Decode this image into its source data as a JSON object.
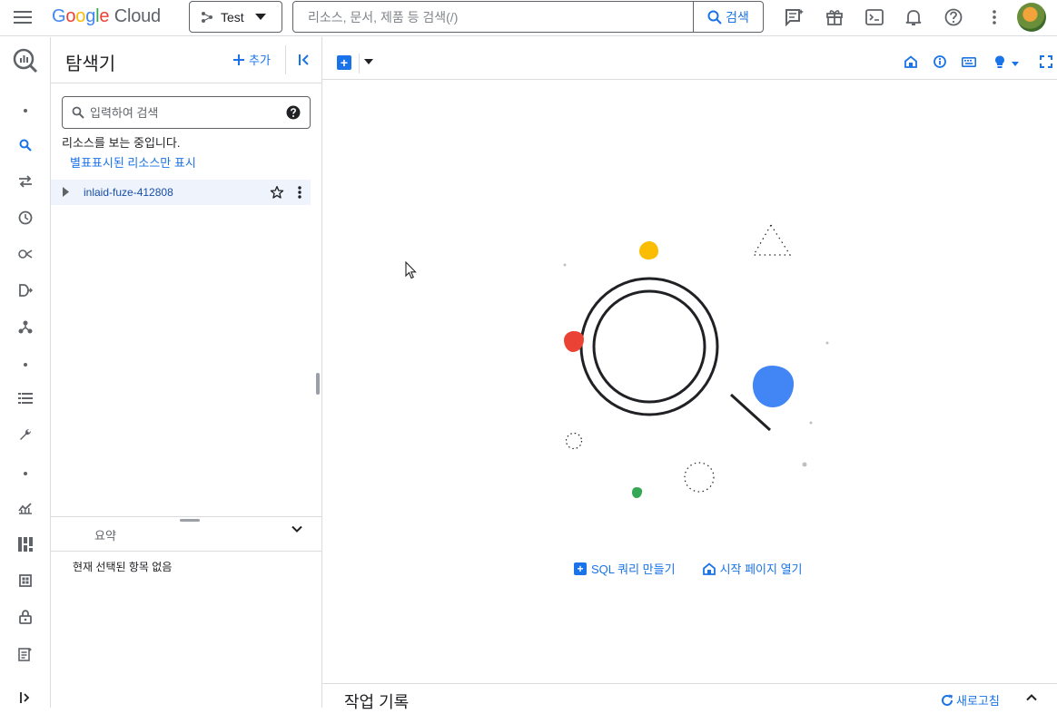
{
  "topbar": {
    "logo_google": [
      "G",
      "o",
      "o",
      "g",
      "l",
      "e"
    ],
    "logo_cloud": "Cloud",
    "project_label": "Test",
    "search_placeholder": "리소스, 문서, 제품 등 검색(/)",
    "search_button": "검색",
    "icons": [
      "menu-icon",
      "project-picker-icon",
      "search-icon",
      "assistant-chat-icon",
      "gift-icon",
      "cloud-shell-icon",
      "notifications-icon",
      "help-icon",
      "more-vert-icon"
    ]
  },
  "leftnav": {
    "icons": [
      "bigquery-logo-icon",
      "dot-icon",
      "search-icon",
      "transfer-icon",
      "history-icon",
      "analytics-hub-icon",
      "dataform-icon",
      "pipeline-icon",
      "dot-icon",
      "list-icon",
      "wrench-icon",
      "dot-icon",
      "monitoring-chart-icon",
      "dashboard-icon",
      "table-grid-icon",
      "lock-icon",
      "release-notes-icon",
      "expand-nav-icon"
    ]
  },
  "explorer": {
    "title": "탐색기",
    "add_label": "추가",
    "search_placeholder": "입력하여 검색",
    "viewing_text": "리소스를 보는 중입니다.",
    "starred_link": "별표표시된 리소스만 표시",
    "project_name": "inlaid-fuze-412808",
    "summary_title": "요약",
    "summary_empty": "현재 선택된 항목 없음"
  },
  "main": {
    "actions": {
      "create_sql": "SQL 쿼리 만들기",
      "open_welcome": "시작 페이지 열기"
    },
    "history_title": "작업 기록",
    "refresh_label": "새로고침"
  },
  "colors": {
    "accent": "#1a73e8",
    "yellow_blob": "#fbbc04",
    "red_blob": "#ea4335",
    "blue_blob": "#4285f4",
    "green_blob": "#34a853"
  }
}
